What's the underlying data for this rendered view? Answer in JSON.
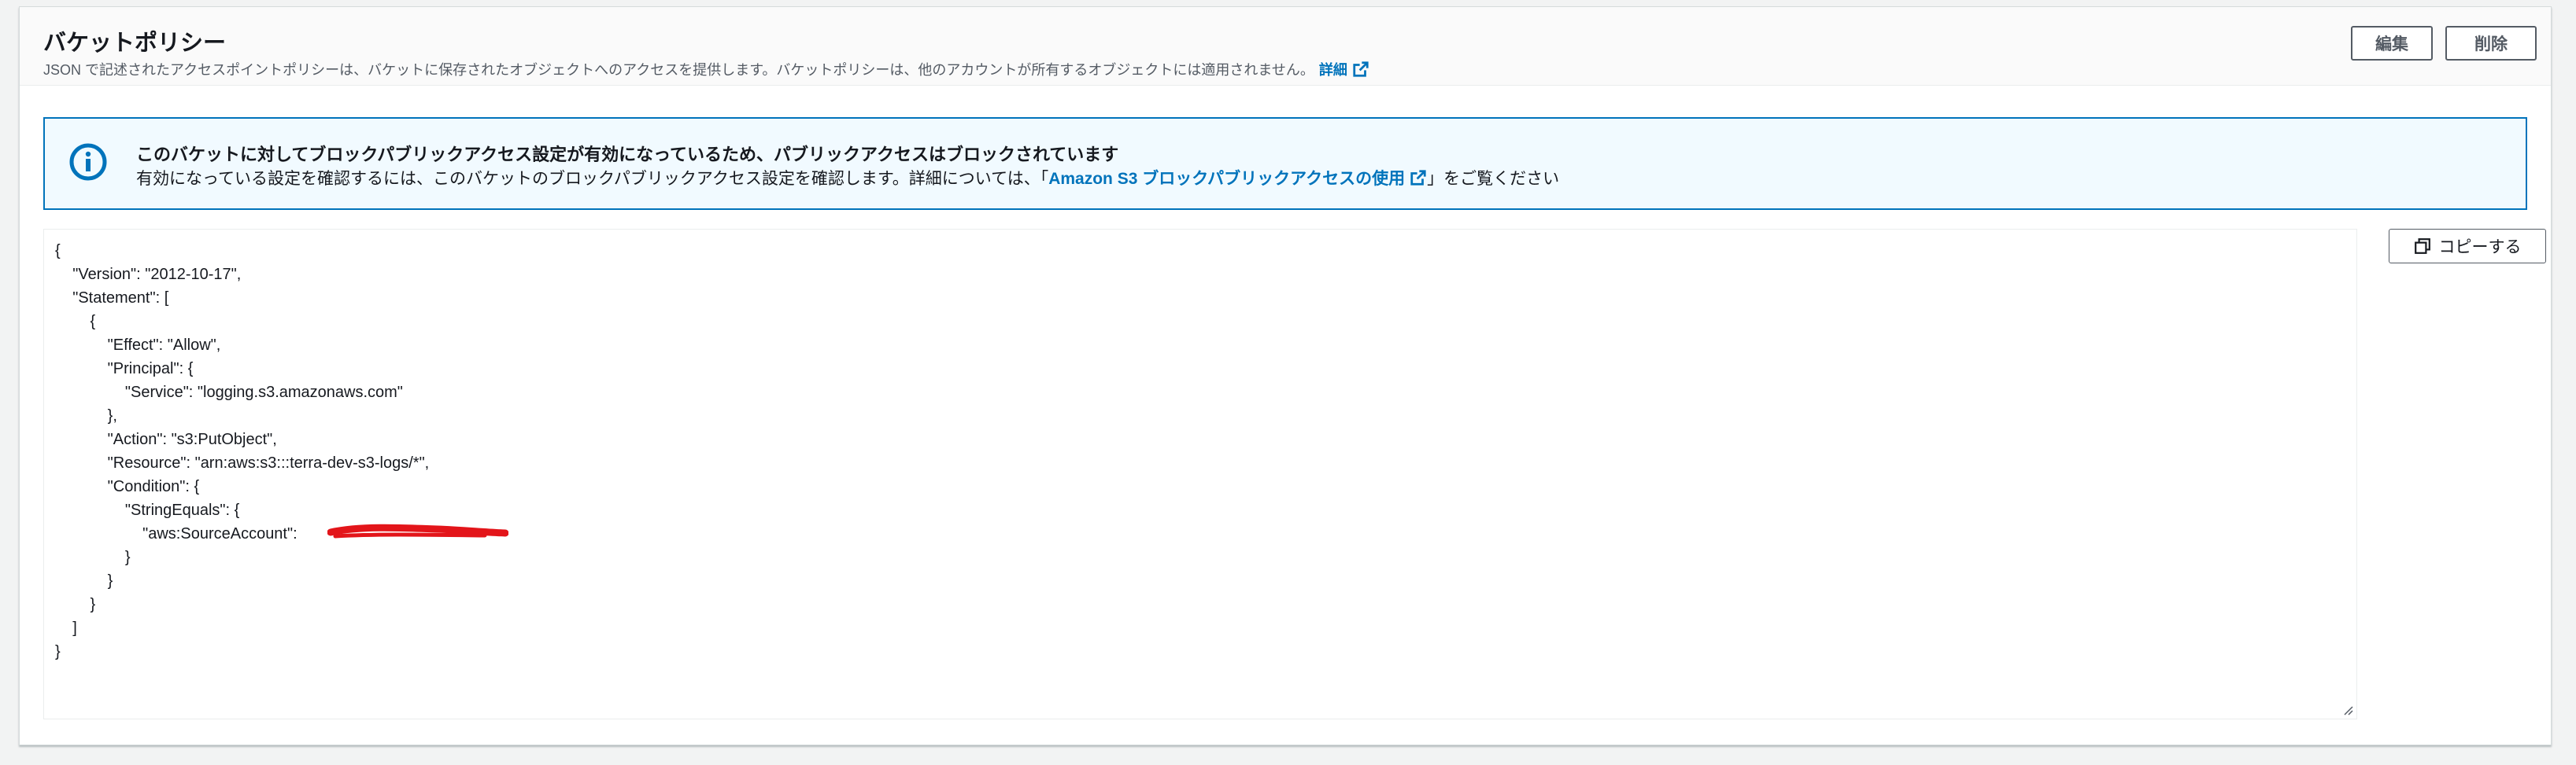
{
  "header": {
    "title": "バケットポリシー",
    "description": "JSON で記述されたアクセスポイントポリシーは、バケットに保存されたオブジェクトへのアクセスを提供します。バケットポリシーは、他のアカウントが所有するオブジェクトには適用されません。",
    "details_link": "詳細",
    "edit_label": "編集",
    "delete_label": "削除"
  },
  "alert": {
    "title": "このバケットに対してブロックパブリックアクセス設定が有効になっているため、パブリックアクセスはブロックされています",
    "body_prefix": "有効になっている設定を確認するには、このバケットのブロックパブリックアクセス設定を確認します。詳細については、「",
    "body_link": "Amazon S3 ブロックパブリックアクセスの使用",
    "body_suffix": "」をご覧ください"
  },
  "policy": {
    "copy_label": "コピーする",
    "json_text": "{\n    \"Version\": \"2012-10-17\",\n    \"Statement\": [\n        {\n            \"Effect\": \"Allow\",\n            \"Principal\": {\n                \"Service\": \"logging.s3.amazonaws.com\"\n            },\n            \"Action\": \"s3:PutObject\",\n            \"Resource\": \"arn:aws:s3:::terra-dev-s3-logs/*\",\n            \"Condition\": {\n                \"StringEquals\": {\n                    \"aws:SourceAccount\": \n                }\n            }\n        }\n    ]\n}"
  },
  "colors": {
    "link": "#0073bb",
    "alert_border": "#0073bb",
    "alert_bg": "#f1faff",
    "redaction": "#e3151a"
  },
  "icons": {
    "alert": "info-circle-icon",
    "external": "external-link-icon",
    "copy": "copy-icon",
    "redaction": "redaction-mark"
  }
}
